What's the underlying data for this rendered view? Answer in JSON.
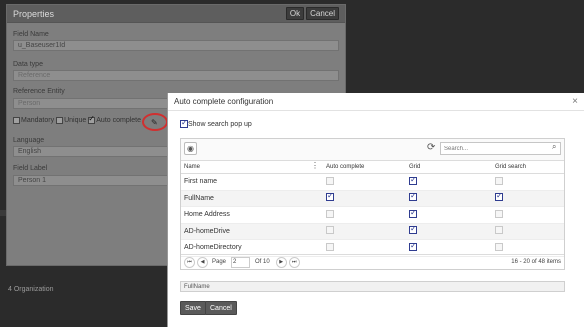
{
  "properties": {
    "title": "Properties",
    "ok_label": "Ok",
    "cancel_label": "Cancel",
    "field_name_label": "Field Name",
    "field_name_value": "u_Baseuser1Id",
    "data_type_label": "Data type",
    "data_type_value": "Reference",
    "reference_entity_label": "Reference Entity",
    "reference_entity_value": "Person",
    "mandatory_label": "Mandatory",
    "unique_label": "Unique",
    "auto_complete_label": "Auto complete",
    "language_label": "Language",
    "language_value": "English",
    "field_label_label": "Field Label",
    "field_label_value": "Person 1"
  },
  "background": {
    "label": "4 Organization"
  },
  "dialog": {
    "title": "Auto complete configuration",
    "close_glyph": "×",
    "show_search_popup_label": "Show search pop up",
    "search_placeholder": "Search...",
    "columns": [
      "Name",
      "Auto complete",
      "Grid",
      "Grid search"
    ],
    "rows": [
      {
        "name": "First name",
        "auto_complete": false,
        "grid": true,
        "grid_search": false
      },
      {
        "name": "FullName",
        "auto_complete": true,
        "grid": true,
        "grid_search": true
      },
      {
        "name": "Home Address",
        "auto_complete": false,
        "grid": true,
        "grid_search": false
      },
      {
        "name": "AD-homeDrive",
        "auto_complete": false,
        "grid": true,
        "grid_search": false
      },
      {
        "name": "AD-homeDirectory",
        "auto_complete": false,
        "grid": true,
        "grid_search": false
      }
    ],
    "pager": {
      "page_label": "Page",
      "page_value": "2",
      "of_label": "Of 10",
      "items_label": "16 - 20 of 48 items"
    },
    "selected_field": "FullName",
    "save_label": "Save",
    "cancel_label": "Cancel"
  },
  "icons": {
    "eye": "eye-icon",
    "refresh": "refresh-icon",
    "search": "search-icon",
    "pencil": "pencil-icon",
    "menu": "column-menu-icon"
  },
  "colors": {
    "checkbox_checked": "#2f3c90",
    "highlight_circle": "#d03030"
  }
}
